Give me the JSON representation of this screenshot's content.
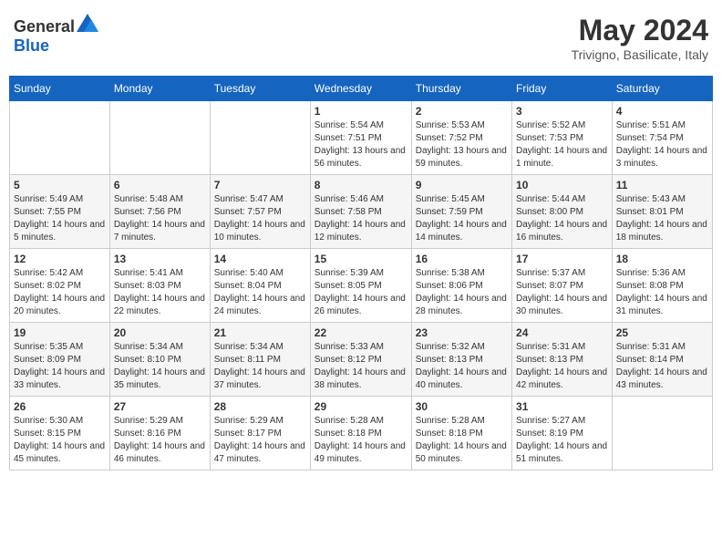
{
  "header": {
    "logo_general": "General",
    "logo_blue": "Blue",
    "title": "May 2024",
    "subtitle": "Trivigno, Basilicate, Italy"
  },
  "weekdays": [
    "Sunday",
    "Monday",
    "Tuesday",
    "Wednesday",
    "Thursday",
    "Friday",
    "Saturday"
  ],
  "weeks": [
    [
      {
        "day": "",
        "sunrise": "",
        "sunset": "",
        "daylight": ""
      },
      {
        "day": "",
        "sunrise": "",
        "sunset": "",
        "daylight": ""
      },
      {
        "day": "",
        "sunrise": "",
        "sunset": "",
        "daylight": ""
      },
      {
        "day": "1",
        "sunrise": "Sunrise: 5:54 AM",
        "sunset": "Sunset: 7:51 PM",
        "daylight": "Daylight: 13 hours and 56 minutes."
      },
      {
        "day": "2",
        "sunrise": "Sunrise: 5:53 AM",
        "sunset": "Sunset: 7:52 PM",
        "daylight": "Daylight: 13 hours and 59 minutes."
      },
      {
        "day": "3",
        "sunrise": "Sunrise: 5:52 AM",
        "sunset": "Sunset: 7:53 PM",
        "daylight": "Daylight: 14 hours and 1 minute."
      },
      {
        "day": "4",
        "sunrise": "Sunrise: 5:51 AM",
        "sunset": "Sunset: 7:54 PM",
        "daylight": "Daylight: 14 hours and 3 minutes."
      }
    ],
    [
      {
        "day": "5",
        "sunrise": "Sunrise: 5:49 AM",
        "sunset": "Sunset: 7:55 PM",
        "daylight": "Daylight: 14 hours and 5 minutes."
      },
      {
        "day": "6",
        "sunrise": "Sunrise: 5:48 AM",
        "sunset": "Sunset: 7:56 PM",
        "daylight": "Daylight: 14 hours and 7 minutes."
      },
      {
        "day": "7",
        "sunrise": "Sunrise: 5:47 AM",
        "sunset": "Sunset: 7:57 PM",
        "daylight": "Daylight: 14 hours and 10 minutes."
      },
      {
        "day": "8",
        "sunrise": "Sunrise: 5:46 AM",
        "sunset": "Sunset: 7:58 PM",
        "daylight": "Daylight: 14 hours and 12 minutes."
      },
      {
        "day": "9",
        "sunrise": "Sunrise: 5:45 AM",
        "sunset": "Sunset: 7:59 PM",
        "daylight": "Daylight: 14 hours and 14 minutes."
      },
      {
        "day": "10",
        "sunrise": "Sunrise: 5:44 AM",
        "sunset": "Sunset: 8:00 PM",
        "daylight": "Daylight: 14 hours and 16 minutes."
      },
      {
        "day": "11",
        "sunrise": "Sunrise: 5:43 AM",
        "sunset": "Sunset: 8:01 PM",
        "daylight": "Daylight: 14 hours and 18 minutes."
      }
    ],
    [
      {
        "day": "12",
        "sunrise": "Sunrise: 5:42 AM",
        "sunset": "Sunset: 8:02 PM",
        "daylight": "Daylight: 14 hours and 20 minutes."
      },
      {
        "day": "13",
        "sunrise": "Sunrise: 5:41 AM",
        "sunset": "Sunset: 8:03 PM",
        "daylight": "Daylight: 14 hours and 22 minutes."
      },
      {
        "day": "14",
        "sunrise": "Sunrise: 5:40 AM",
        "sunset": "Sunset: 8:04 PM",
        "daylight": "Daylight: 14 hours and 24 minutes."
      },
      {
        "day": "15",
        "sunrise": "Sunrise: 5:39 AM",
        "sunset": "Sunset: 8:05 PM",
        "daylight": "Daylight: 14 hours and 26 minutes."
      },
      {
        "day": "16",
        "sunrise": "Sunrise: 5:38 AM",
        "sunset": "Sunset: 8:06 PM",
        "daylight": "Daylight: 14 hours and 28 minutes."
      },
      {
        "day": "17",
        "sunrise": "Sunrise: 5:37 AM",
        "sunset": "Sunset: 8:07 PM",
        "daylight": "Daylight: 14 hours and 30 minutes."
      },
      {
        "day": "18",
        "sunrise": "Sunrise: 5:36 AM",
        "sunset": "Sunset: 8:08 PM",
        "daylight": "Daylight: 14 hours and 31 minutes."
      }
    ],
    [
      {
        "day": "19",
        "sunrise": "Sunrise: 5:35 AM",
        "sunset": "Sunset: 8:09 PM",
        "daylight": "Daylight: 14 hours and 33 minutes."
      },
      {
        "day": "20",
        "sunrise": "Sunrise: 5:34 AM",
        "sunset": "Sunset: 8:10 PM",
        "daylight": "Daylight: 14 hours and 35 minutes."
      },
      {
        "day": "21",
        "sunrise": "Sunrise: 5:34 AM",
        "sunset": "Sunset: 8:11 PM",
        "daylight": "Daylight: 14 hours and 37 minutes."
      },
      {
        "day": "22",
        "sunrise": "Sunrise: 5:33 AM",
        "sunset": "Sunset: 8:12 PM",
        "daylight": "Daylight: 14 hours and 38 minutes."
      },
      {
        "day": "23",
        "sunrise": "Sunrise: 5:32 AM",
        "sunset": "Sunset: 8:13 PM",
        "daylight": "Daylight: 14 hours and 40 minutes."
      },
      {
        "day": "24",
        "sunrise": "Sunrise: 5:31 AM",
        "sunset": "Sunset: 8:13 PM",
        "daylight": "Daylight: 14 hours and 42 minutes."
      },
      {
        "day": "25",
        "sunrise": "Sunrise: 5:31 AM",
        "sunset": "Sunset: 8:14 PM",
        "daylight": "Daylight: 14 hours and 43 minutes."
      }
    ],
    [
      {
        "day": "26",
        "sunrise": "Sunrise: 5:30 AM",
        "sunset": "Sunset: 8:15 PM",
        "daylight": "Daylight: 14 hours and 45 minutes."
      },
      {
        "day": "27",
        "sunrise": "Sunrise: 5:29 AM",
        "sunset": "Sunset: 8:16 PM",
        "daylight": "Daylight: 14 hours and 46 minutes."
      },
      {
        "day": "28",
        "sunrise": "Sunrise: 5:29 AM",
        "sunset": "Sunset: 8:17 PM",
        "daylight": "Daylight: 14 hours and 47 minutes."
      },
      {
        "day": "29",
        "sunrise": "Sunrise: 5:28 AM",
        "sunset": "Sunset: 8:18 PM",
        "daylight": "Daylight: 14 hours and 49 minutes."
      },
      {
        "day": "30",
        "sunrise": "Sunrise: 5:28 AM",
        "sunset": "Sunset: 8:18 PM",
        "daylight": "Daylight: 14 hours and 50 minutes."
      },
      {
        "day": "31",
        "sunrise": "Sunrise: 5:27 AM",
        "sunset": "Sunset: 8:19 PM",
        "daylight": "Daylight: 14 hours and 51 minutes."
      },
      {
        "day": "",
        "sunrise": "",
        "sunset": "",
        "daylight": ""
      }
    ]
  ]
}
